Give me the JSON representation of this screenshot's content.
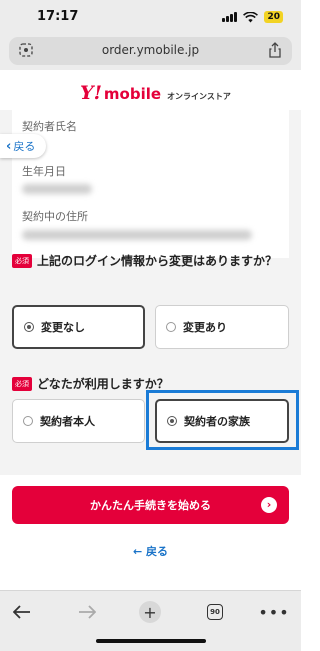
{
  "status": {
    "time": "17:17",
    "battery": "20"
  },
  "browser": {
    "url": "order.ymobile.jp",
    "tabs_count": "90"
  },
  "header": {
    "logo_y": "Y!",
    "logo_text": "mobile",
    "logo_sub": "オンラインストア"
  },
  "info": {
    "back_label": "戻る",
    "fields": [
      "契約者氏名",
      "生年月日",
      "契約中の住所"
    ]
  },
  "q1": {
    "badge": "必須",
    "text": "上記のログイン情報から変更はありますか？",
    "options": [
      "変更なし",
      "変更あり"
    ],
    "selected": 0
  },
  "q2": {
    "badge": "必須",
    "text": "どなたが利用しますか？",
    "options": [
      "契約者本人",
      "契約者の家族"
    ],
    "selected": 1
  },
  "actions": {
    "start_label": "かんたん手続きを始める",
    "back_link": "戻る"
  },
  "colors": {
    "brand": "#e4003a",
    "link": "#1a73c8",
    "highlight": "#1a7bd6"
  }
}
